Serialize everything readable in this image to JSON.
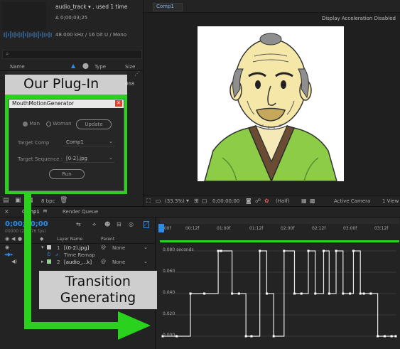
{
  "project": {
    "item_name": "audio_track",
    "item_used": ", used 1 time",
    "duration": "Δ 0;00;03;25",
    "audio_info": "48.000 kHz / 16 bit U / Mono",
    "search_placeholder": "",
    "columns": {
      "name": "Name",
      "type": "Type",
      "size": "Size"
    },
    "bpc": "8 bpc"
  },
  "viewer": {
    "tab_label": "Comp1",
    "status": "Display Acceleration Disabled",
    "zoom": "(33.3%)",
    "time": "0;00;00;00",
    "resolution": "(Half)",
    "camera": "Active Camera",
    "views": "1 View"
  },
  "plugin": {
    "banner": "Our Plug-In",
    "title": "MouthMotionGenerator",
    "gender_man": "Man",
    "gender_woman": "Woman",
    "update_button": "Update",
    "target_comp_label": "Target Comp",
    "target_comp_value": "Comp1",
    "target_seq_label": "Target Sequence :",
    "target_seq_value": "[0-2].jpg",
    "run_button": "Run"
  },
  "timeline": {
    "comp_tab": "Comp1",
    "render_queue": "Render Queue",
    "timecode": "0;00;00;00",
    "fps": "00000 (23.976 fps)",
    "column_layer_name": "Layer Name",
    "column_parent": "Parent",
    "layers": [
      {
        "index": "1",
        "name": "[(0-2).jpg]",
        "parent": "None"
      },
      {
        "index": "",
        "name": "Time Remap",
        "parent": ""
      },
      {
        "index": "2",
        "name": "[audio_...k]",
        "parent": "None"
      }
    ],
    "ruler": [
      "0:00f",
      "00:12f",
      "01:00f",
      "01:12f",
      "02:00f",
      "02:12f",
      "03:00f",
      "03:12f"
    ],
    "graph_labels": [
      "0.080 seconds",
      "0.060",
      "0.040",
      "0.020",
      "0.000"
    ]
  },
  "annotation": {
    "line1": "Transition",
    "line2": "Generating"
  },
  "chart_data": {
    "type": "line",
    "title": "",
    "xlabel": "",
    "ylabel": "",
    "ylim": [
      0,
      0.08
    ],
    "x": [
      0,
      20,
      40,
      60,
      80,
      84,
      100,
      110,
      120,
      128,
      140,
      150,
      160,
      175,
      190,
      200,
      210,
      220,
      232,
      240,
      250,
      260,
      270,
      275,
      285,
      290,
      300,
      310,
      320,
      330,
      336
    ],
    "values": [
      0.0,
      0.0,
      0.04,
      0.04,
      0.08,
      0.08,
      0.04,
      0.04,
      0.0,
      0.0,
      0.08,
      0.04,
      0.0,
      0.08,
      0.04,
      0.04,
      0.08,
      0.04,
      0.08,
      0.04,
      0.08,
      0.04,
      0.04,
      0.08,
      0.04,
      0.04,
      0.04,
      0.0,
      0.0,
      0.0,
      0.0
    ],
    "color": "#e8e8e8"
  }
}
